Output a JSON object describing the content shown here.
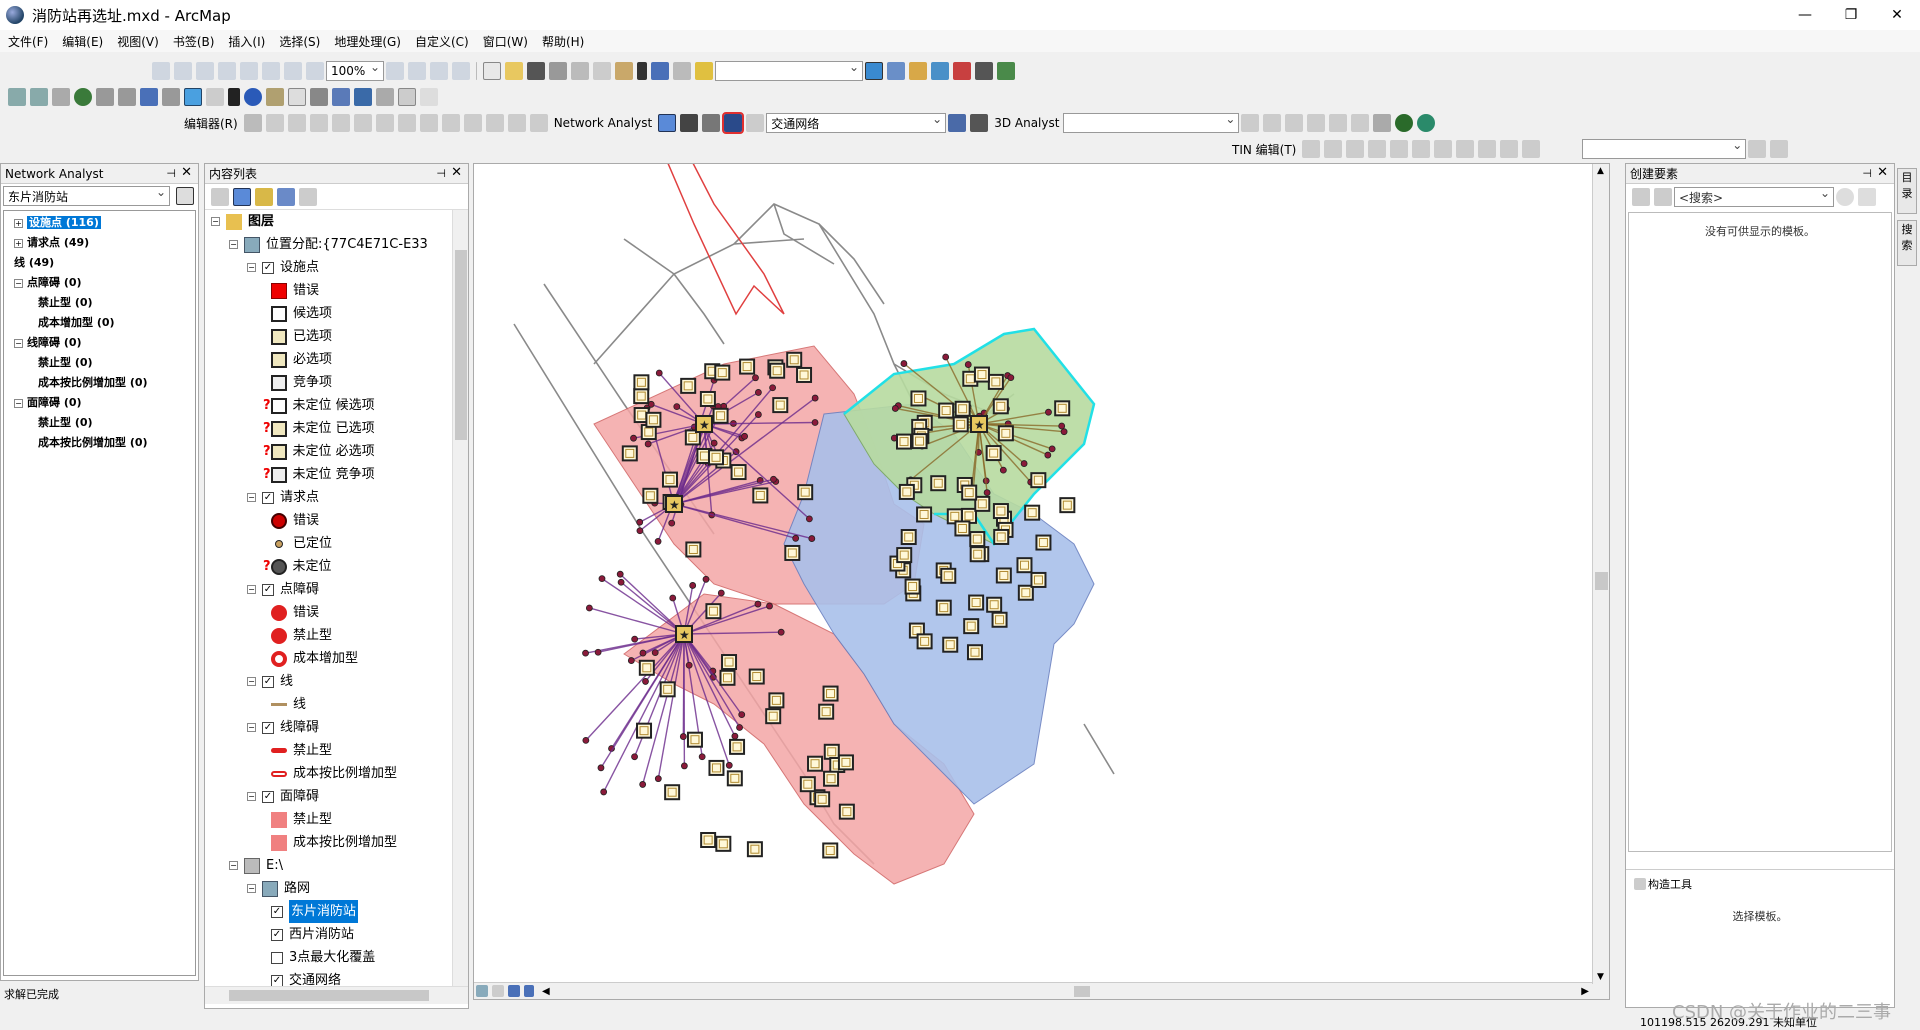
{
  "window": {
    "title": "消防站再选址.mxd - ArcMap",
    "min": "—",
    "max": "❐",
    "close": "✕"
  },
  "menu": [
    "文件(F)",
    "编辑(E)",
    "视图(V)",
    "书签(B)",
    "插入(I)",
    "选择(S)",
    "地理处理(G)",
    "自定义(C)",
    "窗口(W)",
    "帮助(H)"
  ],
  "toolbar": {
    "zoom_value": "100%",
    "editor_label": "编辑器(R)",
    "network_analyst_label": "Network Analyst",
    "network_dataset": "交通网络",
    "analyst3d_label": "3D Analyst",
    "tin_label": "TIN 编辑(T)"
  },
  "na_panel": {
    "title": "Network Analyst",
    "layer": "东片消防站",
    "items": [
      {
        "label": "设施点 (116)",
        "level": 0,
        "exp": "+",
        "selected": true
      },
      {
        "label": "请求点 (49)",
        "level": 0,
        "exp": "+"
      },
      {
        "label": "线 (49)",
        "level": 0,
        "exp": ""
      },
      {
        "label": "点障碍 (0)",
        "level": 0,
        "exp": "−"
      },
      {
        "label": "禁止型 (0)",
        "level": 1
      },
      {
        "label": "成本增加型 (0)",
        "level": 1
      },
      {
        "label": "线障碍 (0)",
        "level": 0,
        "exp": "−"
      },
      {
        "label": "禁止型 (0)",
        "level": 1
      },
      {
        "label": "成本按比例增加型 (0)",
        "level": 1
      },
      {
        "label": "面障碍 (0)",
        "level": 0,
        "exp": "−"
      },
      {
        "label": "禁止型 (0)",
        "level": 1
      },
      {
        "label": "成本按比例增加型 (0)",
        "level": 1
      }
    ]
  },
  "toc": {
    "title": "内容列表",
    "root": "图层",
    "la_layer": "位置分配:{77C4E71C-E33",
    "facilities": "设施点",
    "fac_items": [
      "错误",
      "候选项",
      "已选项",
      "必选项",
      "竞争项",
      "未定位 候选项",
      "未定位 已选项",
      "未定位 必选项",
      "未定位 竞争项"
    ],
    "demand": "请求点",
    "demand_items": [
      "错误",
      "已定位",
      "未定位"
    ],
    "pbarriers": "点障碍",
    "pbarrier_items": [
      "错误",
      "禁止型",
      "成本增加型"
    ],
    "lines": "线",
    "lines_items": [
      "线"
    ],
    "lbarriers": "线障碍",
    "lbarrier_items": [
      "禁止型",
      "成本按比例增加型"
    ],
    "polybarriers": "面障碍",
    "polybarrier_items": [
      "禁止型",
      "成本按比例增加型"
    ],
    "drive": "E:\\",
    "roadnet": "路网",
    "road_items": [
      "东片消防站",
      "西片消防站",
      "3点最大化覆盖",
      "交通网络"
    ]
  },
  "create_panel": {
    "title": "创建要素",
    "search_placeholder": "<搜索>",
    "empty": "没有可供显示的模板。",
    "tools_title": "构造工具",
    "tools_empty": "选择模板。"
  },
  "side_tabs": [
    "目录",
    "搜索"
  ],
  "status": {
    "left": "求解已完成",
    "coords": "101198.515  26209.291 未知单位",
    "watermark": "CSDN @关于作业的二三事"
  },
  "colors": {
    "zone_red": "#f4a6a6",
    "zone_blue": "#a9c0ea",
    "zone_green": "#b7dba0",
    "cyan": "#21e0e6",
    "lines_purple": "#6b2a8c",
    "lines_brown": "#8a6a2a",
    "highlight": "#0078d7"
  }
}
